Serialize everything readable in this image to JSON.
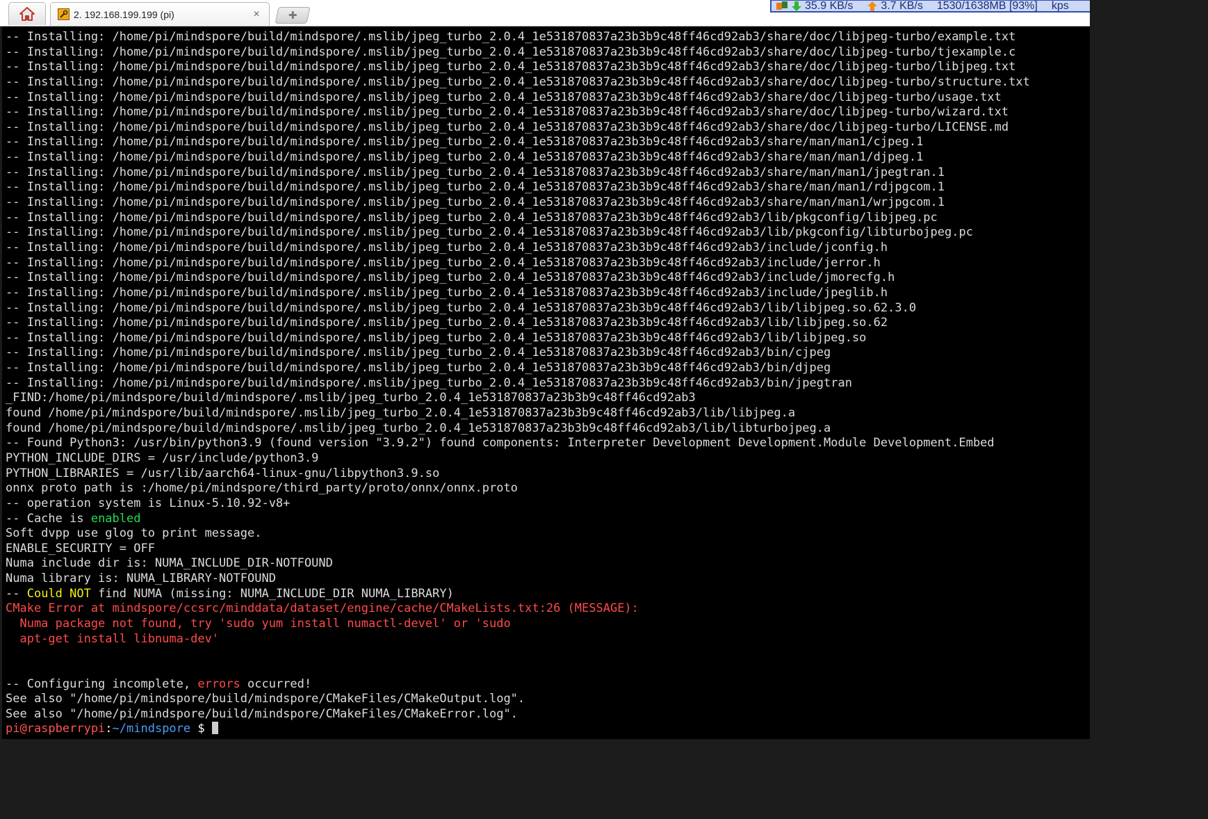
{
  "tabbar": {
    "home_icon": "home-icon",
    "tab": {
      "label": "2. 192.168.199.199 (pi)",
      "icon": "wrench-icon",
      "close": "×"
    },
    "new_tab_icon": "plus-icon",
    "netmon": {
      "download": "35.9 KB/s",
      "upload": "3.7 KB/s",
      "memory": "1530/1638MB [93%]",
      "extra": "kps"
    }
  },
  "terminal": {
    "lines": [
      [
        {
          "t": "-- Installing: /home/pi/mindspore/build/mindspore/.mslib/jpeg_turbo_2.0.4_1e531870837a23b3b9c48ff46cd92ab3/share/doc/libjpeg-turbo/example.txt",
          "c": ""
        }
      ],
      [
        {
          "t": "-- Installing: /home/pi/mindspore/build/mindspore/.mslib/jpeg_turbo_2.0.4_1e531870837a23b3b9c48ff46cd92ab3/share/doc/libjpeg-turbo/tjexample.c",
          "c": ""
        }
      ],
      [
        {
          "t": "-- Installing: /home/pi/mindspore/build/mindspore/.mslib/jpeg_turbo_2.0.4_1e531870837a23b3b9c48ff46cd92ab3/share/doc/libjpeg-turbo/libjpeg.txt",
          "c": ""
        }
      ],
      [
        {
          "t": "-- Installing: /home/pi/mindspore/build/mindspore/.mslib/jpeg_turbo_2.0.4_1e531870837a23b3b9c48ff46cd92ab3/share/doc/libjpeg-turbo/structure.txt",
          "c": ""
        }
      ],
      [
        {
          "t": "-- Installing: /home/pi/mindspore/build/mindspore/.mslib/jpeg_turbo_2.0.4_1e531870837a23b3b9c48ff46cd92ab3/share/doc/libjpeg-turbo/usage.txt",
          "c": ""
        }
      ],
      [
        {
          "t": "-- Installing: /home/pi/mindspore/build/mindspore/.mslib/jpeg_turbo_2.0.4_1e531870837a23b3b9c48ff46cd92ab3/share/doc/libjpeg-turbo/wizard.txt",
          "c": ""
        }
      ],
      [
        {
          "t": "-- Installing: /home/pi/mindspore/build/mindspore/.mslib/jpeg_turbo_2.0.4_1e531870837a23b3b9c48ff46cd92ab3/share/doc/libjpeg-turbo/LICENSE.md",
          "c": ""
        }
      ],
      [
        {
          "t": "-- Installing: /home/pi/mindspore/build/mindspore/.mslib/jpeg_turbo_2.0.4_1e531870837a23b3b9c48ff46cd92ab3/share/man/man1/cjpeg.1",
          "c": ""
        }
      ],
      [
        {
          "t": "-- Installing: /home/pi/mindspore/build/mindspore/.mslib/jpeg_turbo_2.0.4_1e531870837a23b3b9c48ff46cd92ab3/share/man/man1/djpeg.1",
          "c": ""
        }
      ],
      [
        {
          "t": "-- Installing: /home/pi/mindspore/build/mindspore/.mslib/jpeg_turbo_2.0.4_1e531870837a23b3b9c48ff46cd92ab3/share/man/man1/jpegtran.1",
          "c": ""
        }
      ],
      [
        {
          "t": "-- Installing: /home/pi/mindspore/build/mindspore/.mslib/jpeg_turbo_2.0.4_1e531870837a23b3b9c48ff46cd92ab3/share/man/man1/rdjpgcom.1",
          "c": ""
        }
      ],
      [
        {
          "t": "-- Installing: /home/pi/mindspore/build/mindspore/.mslib/jpeg_turbo_2.0.4_1e531870837a23b3b9c48ff46cd92ab3/share/man/man1/wrjpgcom.1",
          "c": ""
        }
      ],
      [
        {
          "t": "-- Installing: /home/pi/mindspore/build/mindspore/.mslib/jpeg_turbo_2.0.4_1e531870837a23b3b9c48ff46cd92ab3/lib/pkgconfig/libjpeg.pc",
          "c": ""
        }
      ],
      [
        {
          "t": "-- Installing: /home/pi/mindspore/build/mindspore/.mslib/jpeg_turbo_2.0.4_1e531870837a23b3b9c48ff46cd92ab3/lib/pkgconfig/libturbojpeg.pc",
          "c": ""
        }
      ],
      [
        {
          "t": "-- Installing: /home/pi/mindspore/build/mindspore/.mslib/jpeg_turbo_2.0.4_1e531870837a23b3b9c48ff46cd92ab3/include/jconfig.h",
          "c": ""
        }
      ],
      [
        {
          "t": "-- Installing: /home/pi/mindspore/build/mindspore/.mslib/jpeg_turbo_2.0.4_1e531870837a23b3b9c48ff46cd92ab3/include/jerror.h",
          "c": ""
        }
      ],
      [
        {
          "t": "-- Installing: /home/pi/mindspore/build/mindspore/.mslib/jpeg_turbo_2.0.4_1e531870837a23b3b9c48ff46cd92ab3/include/jmorecfg.h",
          "c": ""
        }
      ],
      [
        {
          "t": "-- Installing: /home/pi/mindspore/build/mindspore/.mslib/jpeg_turbo_2.0.4_1e531870837a23b3b9c48ff46cd92ab3/include/jpeglib.h",
          "c": ""
        }
      ],
      [
        {
          "t": "-- Installing: /home/pi/mindspore/build/mindspore/.mslib/jpeg_turbo_2.0.4_1e531870837a23b3b9c48ff46cd92ab3/lib/libjpeg.so.62.3.0",
          "c": ""
        }
      ],
      [
        {
          "t": "-- Installing: /home/pi/mindspore/build/mindspore/.mslib/jpeg_turbo_2.0.4_1e531870837a23b3b9c48ff46cd92ab3/lib/libjpeg.so.62",
          "c": ""
        }
      ],
      [
        {
          "t": "-- Installing: /home/pi/mindspore/build/mindspore/.mslib/jpeg_turbo_2.0.4_1e531870837a23b3b9c48ff46cd92ab3/lib/libjpeg.so",
          "c": ""
        }
      ],
      [
        {
          "t": "-- Installing: /home/pi/mindspore/build/mindspore/.mslib/jpeg_turbo_2.0.4_1e531870837a23b3b9c48ff46cd92ab3/bin/cjpeg",
          "c": ""
        }
      ],
      [
        {
          "t": "-- Installing: /home/pi/mindspore/build/mindspore/.mslib/jpeg_turbo_2.0.4_1e531870837a23b3b9c48ff46cd92ab3/bin/djpeg",
          "c": ""
        }
      ],
      [
        {
          "t": "-- Installing: /home/pi/mindspore/build/mindspore/.mslib/jpeg_turbo_2.0.4_1e531870837a23b3b9c48ff46cd92ab3/bin/jpegtran",
          "c": ""
        }
      ],
      [
        {
          "t": "_FIND:/home/pi/mindspore/build/mindspore/.mslib/jpeg_turbo_2.0.4_1e531870837a23b3b9c48ff46cd92ab3",
          "c": ""
        }
      ],
      [
        {
          "t": "found /home/pi/mindspore/build/mindspore/.mslib/jpeg_turbo_2.0.4_1e531870837a23b3b9c48ff46cd92ab3/lib/libjpeg.a",
          "c": ""
        }
      ],
      [
        {
          "t": "found /home/pi/mindspore/build/mindspore/.mslib/jpeg_turbo_2.0.4_1e531870837a23b3b9c48ff46cd92ab3/lib/libturbojpeg.a",
          "c": ""
        }
      ],
      [
        {
          "t": "-- Found Python3: /usr/bin/python3.9 (found version \"3.9.2\") found components: Interpreter Development Development.Module Development.Embed",
          "c": ""
        }
      ],
      [
        {
          "t": "PYTHON_INCLUDE_DIRS = /usr/include/python3.9",
          "c": ""
        }
      ],
      [
        {
          "t": "PYTHON_LIBRARIES = /usr/lib/aarch64-linux-gnu/libpython3.9.so",
          "c": ""
        }
      ],
      [
        {
          "t": "onnx proto path is :/home/pi/mindspore/third_party/proto/onnx/onnx.proto",
          "c": ""
        }
      ],
      [
        {
          "t": "-- operation system is Linux-5.10.92-v8+",
          "c": ""
        }
      ],
      [
        {
          "t": "-- Cache is ",
          "c": ""
        },
        {
          "t": "enabled",
          "c": "green"
        }
      ],
      [
        {
          "t": "Soft dvpp use glog to print message.",
          "c": ""
        }
      ],
      [
        {
          "t": "ENABLE_SECURITY = OFF",
          "c": ""
        }
      ],
      [
        {
          "t": "Numa include dir is: NUMA_INCLUDE_DIR-NOTFOUND",
          "c": ""
        }
      ],
      [
        {
          "t": "Numa library is: NUMA_LIBRARY-NOTFOUND",
          "c": ""
        }
      ],
      [
        {
          "t": "-- ",
          "c": ""
        },
        {
          "t": "Could NOT",
          "c": "yellow"
        },
        {
          "t": " find NUMA (missing: NUMA_INCLUDE_DIR NUMA_LIBRARY)",
          "c": ""
        }
      ],
      [
        {
          "t": "CMake Error at mindspore/ccsrc/minddata/dataset/engine/cache/CMakeLists.txt:26 (MESSAGE):",
          "c": "red"
        }
      ],
      [
        {
          "t": "  Numa package not found, try 'sudo yum install numactl-devel' or 'sudo",
          "c": "red"
        }
      ],
      [
        {
          "t": "  apt-get install libnuma-dev'",
          "c": "red"
        }
      ],
      [
        {
          "t": "",
          "c": ""
        }
      ],
      [
        {
          "t": "",
          "c": ""
        }
      ],
      [
        {
          "t": "-- Configuring incomplete, ",
          "c": ""
        },
        {
          "t": "errors",
          "c": "red"
        },
        {
          "t": " occurred!",
          "c": ""
        }
      ],
      [
        {
          "t": "See also \"/home/pi/mindspore/build/mindspore/CMakeFiles/CMakeOutput.log\".",
          "c": ""
        }
      ],
      [
        {
          "t": "See also \"/home/pi/mindspore/build/mindspore/CMakeFiles/CMakeError.log\".",
          "c": ""
        }
      ]
    ],
    "prompt": {
      "user": "pi@raspberrypi",
      "separator": ":",
      "path": "~/mindspore",
      "symbol": " $ "
    }
  }
}
